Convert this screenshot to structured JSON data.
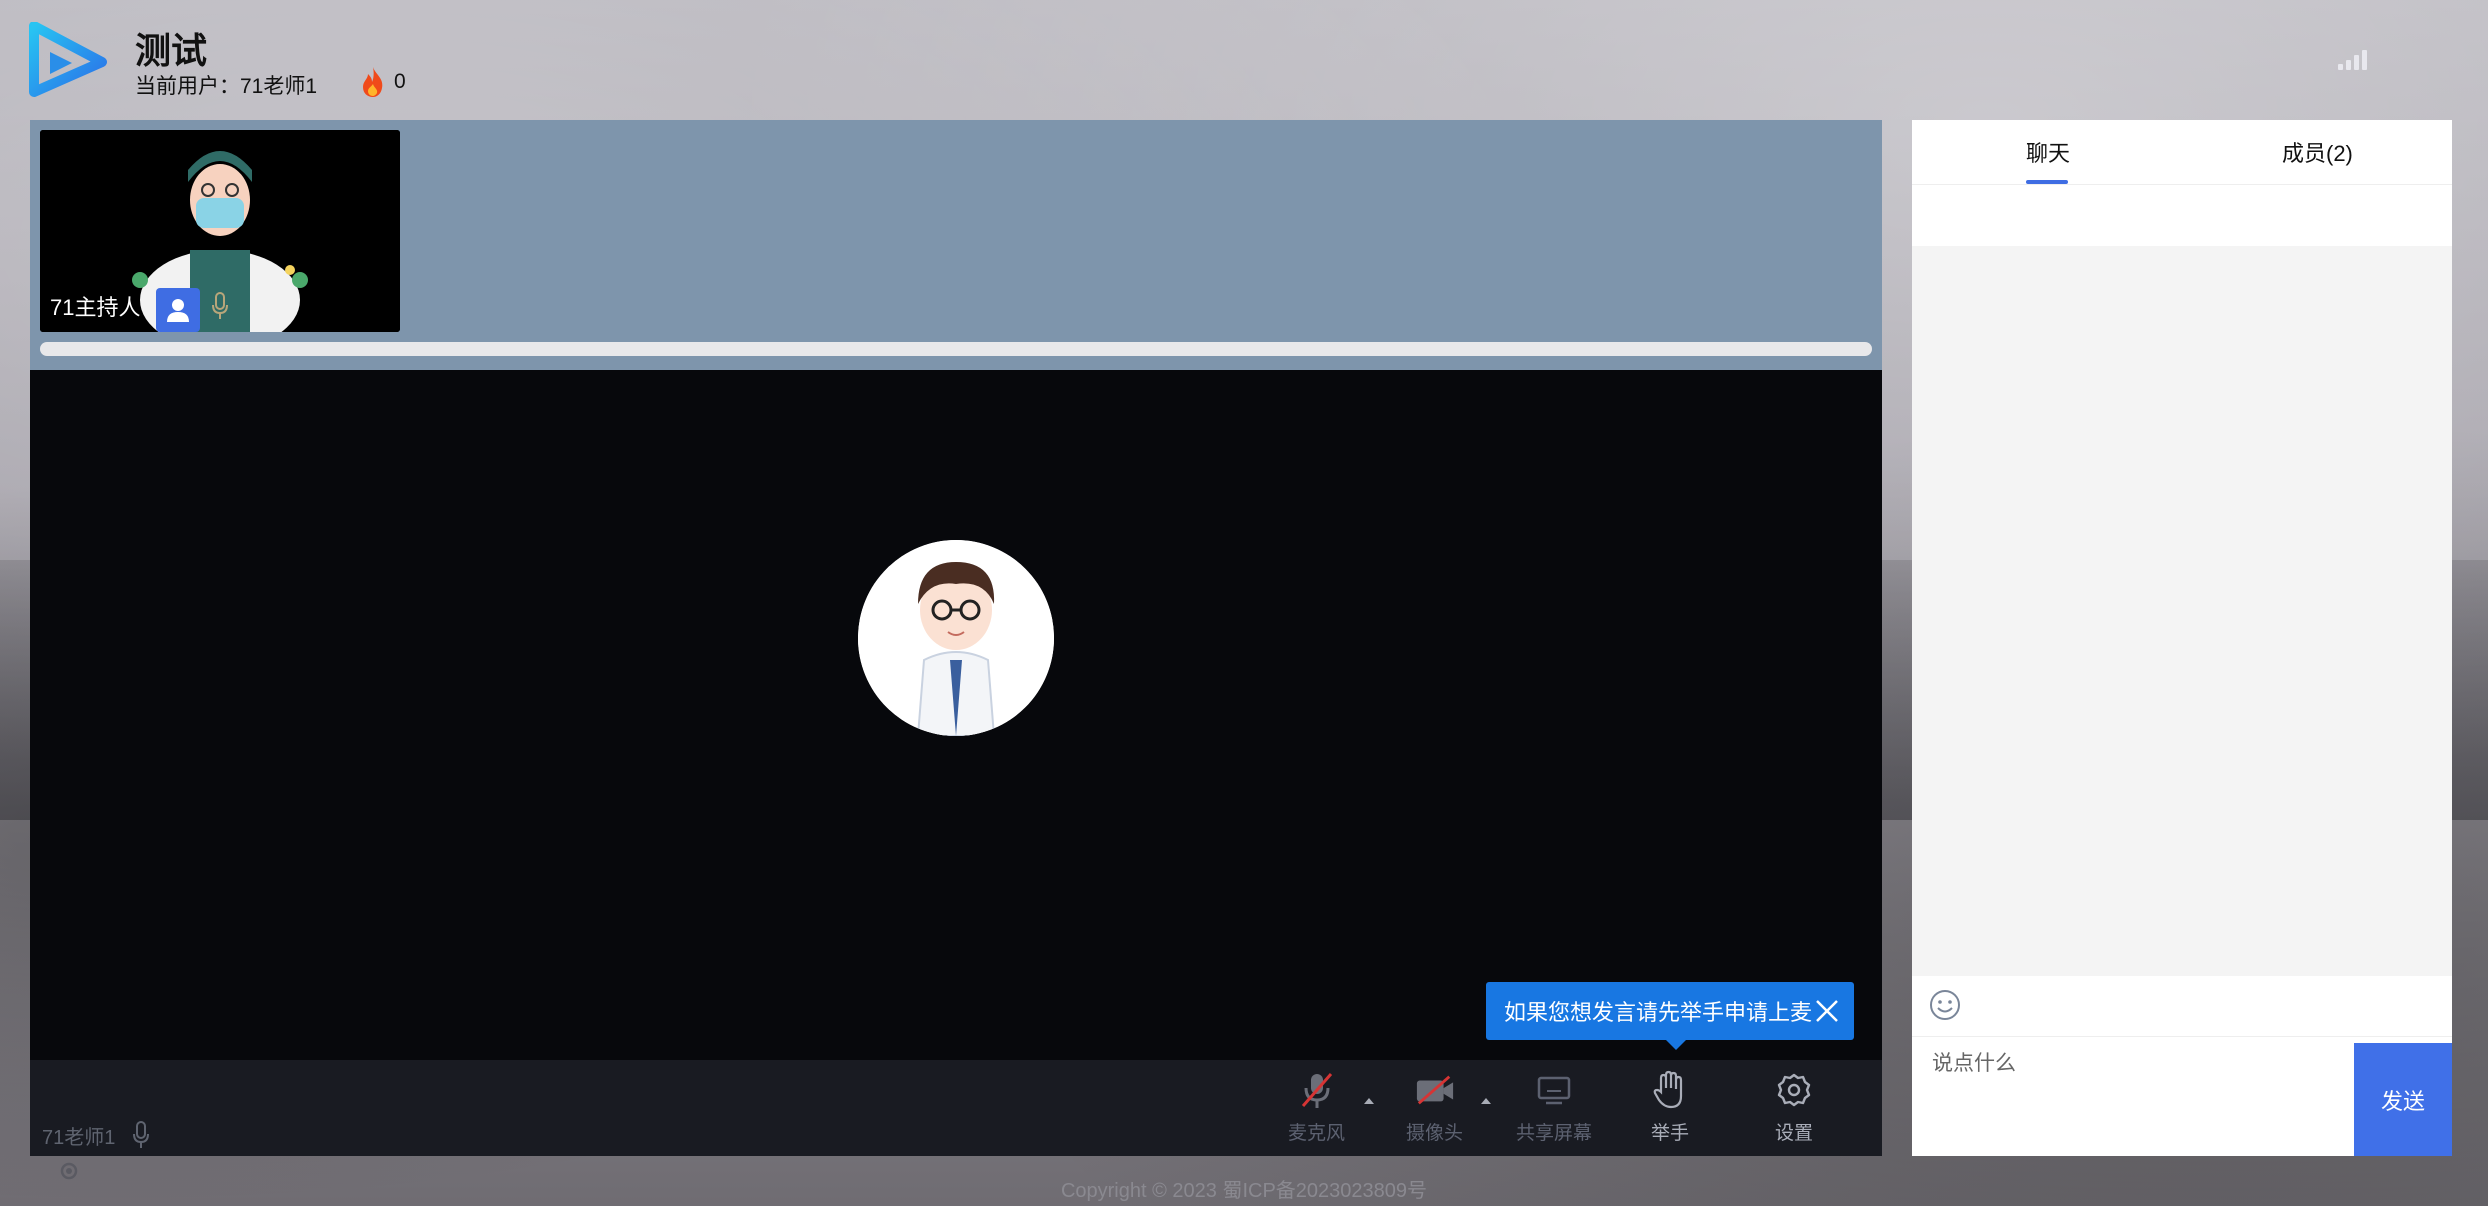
{
  "header": {
    "title": "测试",
    "current_user": "当前用户：71老师1",
    "heat_count": "0"
  },
  "video": {
    "participants": [
      {
        "name": "71主持人"
      }
    ],
    "tooltip": "如果您想发言请先举手申请上麦",
    "self_name": "71老师1"
  },
  "toolbar": {
    "mic_label": "麦克风",
    "camera_label": "摄像头",
    "share_label": "共享屏幕",
    "raise_hand_label": "举手",
    "settings_label": "设置"
  },
  "chat": {
    "tab_chat": "聊天",
    "tab_members": "成员(2)",
    "placeholder": "说点什么",
    "send_label": "发送"
  },
  "footer": {
    "copyright": "Copyright © 2023 蜀ICP备2023023809号"
  },
  "colors": {
    "accent": "#4070e8",
    "tooltip_bg": "#1877e2",
    "strip_bg": "#7e95ac",
    "video_bg": "#07080c"
  }
}
